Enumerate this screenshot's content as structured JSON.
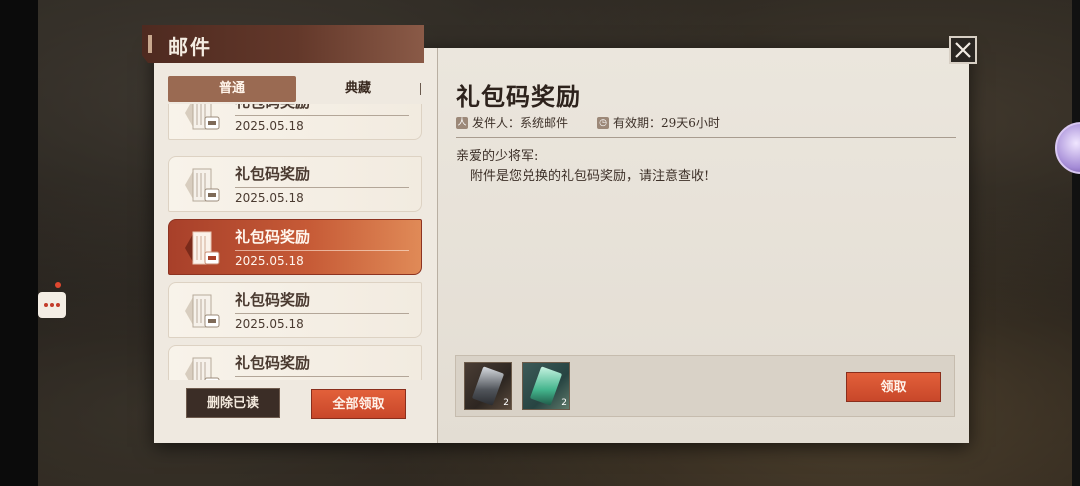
{
  "window": {
    "title": "邮件"
  },
  "tabs": [
    {
      "label": "普通",
      "active": true
    },
    {
      "label": "典藏",
      "active": false
    }
  ],
  "mails": [
    {
      "subject": "礼包码奖励",
      "date": "2025.05.18",
      "selected": false
    },
    {
      "subject": "礼包码奖励",
      "date": "2025.05.18",
      "selected": false
    },
    {
      "subject": "礼包码奖励",
      "date": "2025.05.18",
      "selected": true
    },
    {
      "subject": "礼包码奖励",
      "date": "2025.05.18",
      "selected": false
    },
    {
      "subject": "礼包码奖励",
      "date": "",
      "selected": false
    }
  ],
  "buttons": {
    "delete_read": "删除已读",
    "claim_all": "全部领取",
    "claim": "领取"
  },
  "detail": {
    "title": "礼包码奖励",
    "sender": "发件人：系统邮件",
    "expiry": "有效期：29天6小时",
    "greeting": "亲爱的少将军:",
    "body": "附件是您兑换的礼包码奖励，请注意查收!"
  },
  "attachments": [
    {
      "icon": "dark-card-icon",
      "count": "2"
    },
    {
      "icon": "jade-card-icon",
      "count": "2"
    }
  ],
  "colors": {
    "accent": "#c8472a",
    "banner": "#4e2a20",
    "panel": "#e7e1d8"
  }
}
